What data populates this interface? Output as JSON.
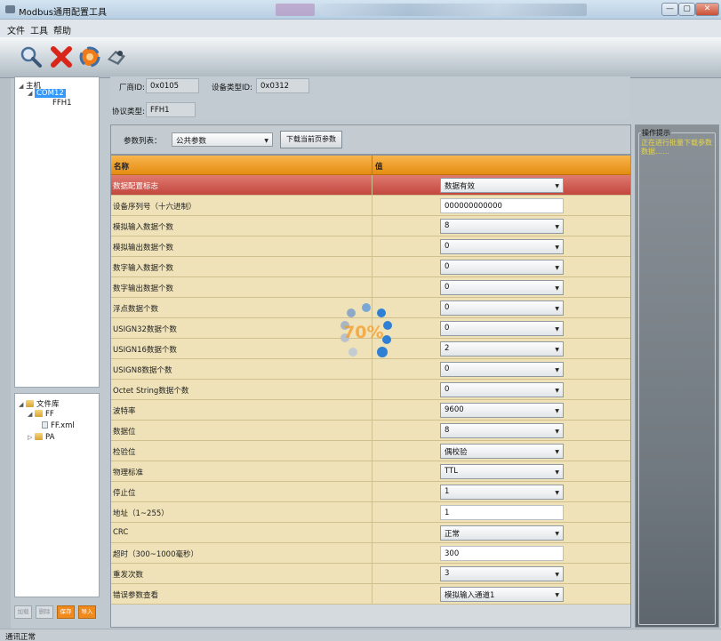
{
  "window": {
    "title": "Modbus通用配置工具",
    "controls": {
      "minimize": "—",
      "maximize": "▢",
      "close": "✕"
    }
  },
  "menu": {
    "file": "文件",
    "tools": "工具",
    "help": "帮助"
  },
  "toolbar": {
    "icons": [
      "search-icon",
      "delete-icon",
      "connect-icon",
      "settings-icon"
    ]
  },
  "tree": {
    "root": "主机",
    "com": "COM12",
    "device": "FFH1"
  },
  "library": {
    "root": "文件库",
    "ff": "FF",
    "ff_file": "FF.xml",
    "pa": "PA"
  },
  "left_buttons": {
    "b1": "加载",
    "b2": "删除",
    "save": "保存",
    "import": "导入"
  },
  "info": {
    "vendor_label": "厂商ID:",
    "vendor_id": "0x0105",
    "device_type_label": "设备类型ID:",
    "device_type_id": "0x0312",
    "protocol_label": "协议类型:",
    "protocol": "FFH1"
  },
  "params": {
    "list_label": "参数列表：",
    "list_selected": "公共参数",
    "download_button": "下载当前页参数",
    "col_name": "名称",
    "col_value": "值",
    "rows": [
      {
        "name": "数据配置标志",
        "value": "数据有效",
        "kind": "combo"
      },
      {
        "name": "设备序列号（十六进制）",
        "value": "000000000000",
        "kind": "text"
      },
      {
        "name": "模拟输入数据个数",
        "value": "8",
        "kind": "combo"
      },
      {
        "name": "模拟输出数据个数",
        "value": "0",
        "kind": "combo"
      },
      {
        "name": "数字输入数据个数",
        "value": "0",
        "kind": "combo"
      },
      {
        "name": "数字输出数据个数",
        "value": "0",
        "kind": "combo"
      },
      {
        "name": "浮点数据个数",
        "value": "0",
        "kind": "combo"
      },
      {
        "name": "USIGN32数据个数",
        "value": "0",
        "kind": "combo"
      },
      {
        "name": "USIGN16数据个数",
        "value": "2",
        "kind": "combo"
      },
      {
        "name": "USIGN8数据个数",
        "value": "0",
        "kind": "combo"
      },
      {
        "name": "Octet String数据个数",
        "value": "0",
        "kind": "combo"
      },
      {
        "name": "波特率",
        "value": "9600",
        "kind": "combo"
      },
      {
        "name": "数据位",
        "value": "8",
        "kind": "combo"
      },
      {
        "name": "检验位",
        "value": "偶校验",
        "kind": "combo"
      },
      {
        "name": "物理标准",
        "value": "TTL",
        "kind": "combo"
      },
      {
        "name": "停止位",
        "value": "1",
        "kind": "combo"
      },
      {
        "name": "地址（1~255）",
        "value": "1",
        "kind": "text"
      },
      {
        "name": "CRC",
        "value": "正常",
        "kind": "combo"
      },
      {
        "name": "超时（300~1000毫秒）",
        "value": "300",
        "kind": "text"
      },
      {
        "name": "重发次数",
        "value": "3",
        "kind": "combo"
      },
      {
        "name": "错误参数查看",
        "value": "模拟输入通道1",
        "kind": "combo"
      }
    ]
  },
  "loading": {
    "percent": "70%",
    "progress": 0.7
  },
  "hints": {
    "title": "操作提示",
    "message": "正在进行批量下载参数数据……"
  },
  "status": {
    "text": "通讯正常"
  },
  "colors": {
    "header_orange": "#e48c11",
    "row_bg": "#efe2b8",
    "alert_row": "#c2473e",
    "selection": "#3399ff",
    "hint_text": "#e6d34a"
  }
}
